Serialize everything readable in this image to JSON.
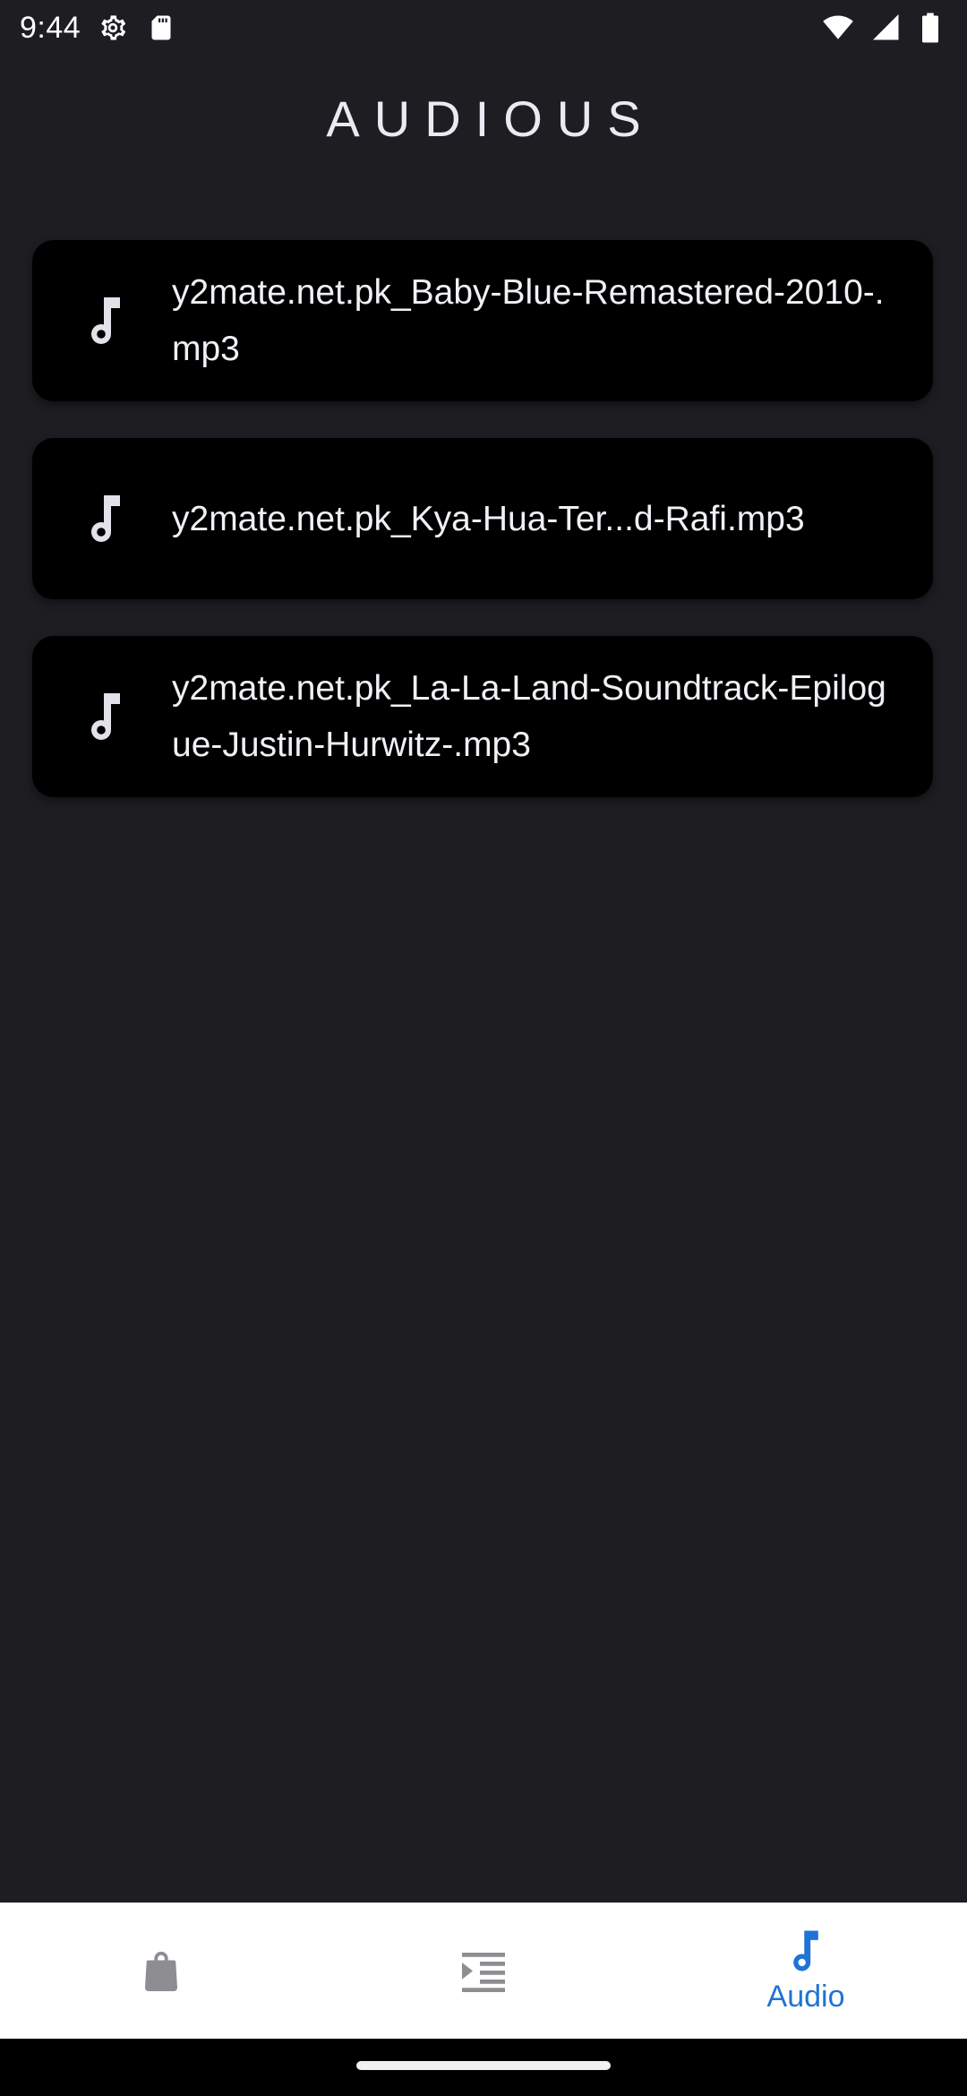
{
  "status_bar": {
    "time": "9:44",
    "left_icons": [
      "settings-icon",
      "sd-card-icon"
    ],
    "right_icons": [
      "wifi-icon",
      "signal-icon",
      "battery-icon"
    ]
  },
  "app": {
    "title": "AUDIOUS"
  },
  "audio_list": {
    "items": [
      {
        "icon": "music-note-icon",
        "name": "y2mate.net.pk_Baby-Blue-Remastered-2010-.mp3"
      },
      {
        "icon": "music-note-icon",
        "name": "y2mate.net.pk_Kya-Hua-Ter...d-Rafi.mp3"
      },
      {
        "icon": "music-note-icon",
        "name": "y2mate.net.pk_La-La-Land-Soundtrack-Epilogue-Justin-Hurwitz-.mp3"
      }
    ]
  },
  "bottom_nav": {
    "items": [
      {
        "icon": "shopping-bag-icon",
        "label": "",
        "active": false
      },
      {
        "icon": "indent-list-icon",
        "label": "",
        "active": false
      },
      {
        "icon": "music-note-icon",
        "label": "Audio",
        "active": true
      }
    ]
  },
  "colors": {
    "background": "#1e1d22",
    "card": "#000000",
    "accent": "#1f73d6",
    "nav_background": "#ffffff",
    "inactive_icon": "#8e8e92"
  }
}
